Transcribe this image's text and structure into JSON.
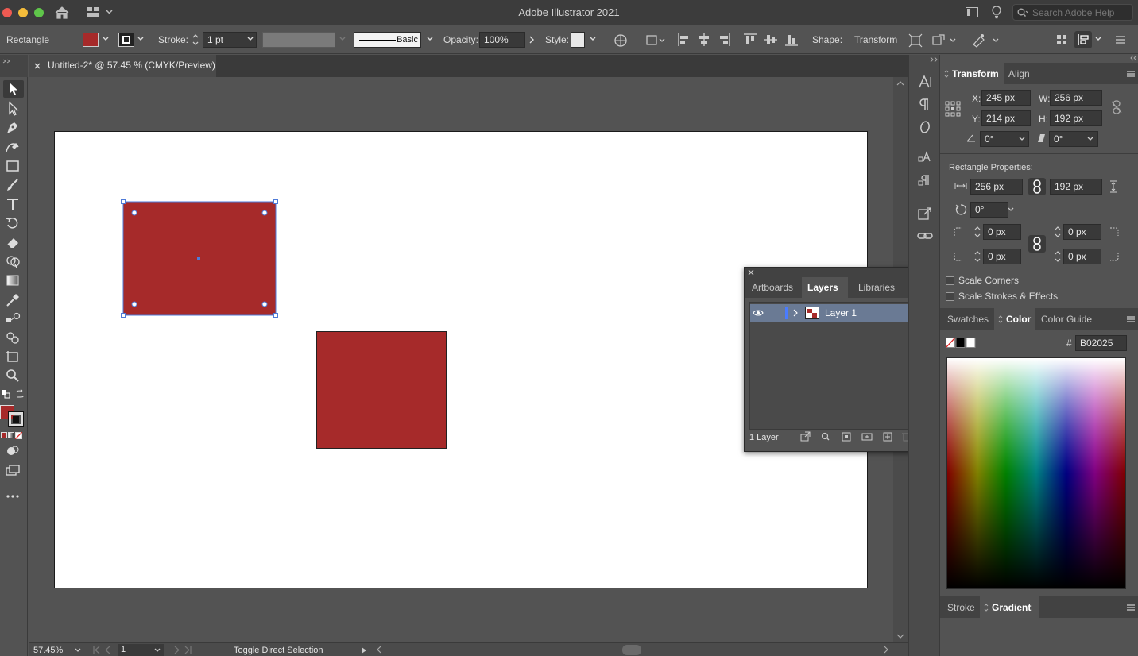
{
  "app": {
    "title": "Adobe Illustrator 2021"
  },
  "search": {
    "placeholder": "Search Adobe Help"
  },
  "control": {
    "object_type": "Rectangle",
    "stroke_label": "Stroke:",
    "stroke_weight": "1 pt",
    "brush_label": "Basic",
    "opacity_label": "Opacity:",
    "opacity_value": "100%",
    "style_label": "Style:",
    "shape_label": "Shape:",
    "transform_label": "Transform",
    "fill_color": "#a62a2a"
  },
  "document": {
    "tab_title": "Untitled-2* @ 57.45 % (CMYK/Preview)"
  },
  "status": {
    "zoom": "57.45%",
    "artboard_number": "1",
    "message": "Toggle Direct Selection"
  },
  "canvas": {
    "shapes": [
      {
        "name": "Rectangle",
        "selected": true,
        "fill": "#a62a2a"
      },
      {
        "name": "Rectangle",
        "selected": false,
        "fill": "#a62a2a"
      }
    ]
  },
  "layers_panel": {
    "tabs": [
      "Artboards",
      "Layers",
      "Libraries"
    ],
    "active_tab": "Layers",
    "layers": [
      {
        "name": "Layer 1",
        "visible": true
      }
    ],
    "footer_count": "1 Layer"
  },
  "transform_panel": {
    "tabs": [
      "Transform",
      "Align"
    ],
    "x": "245 px",
    "y": "214 px",
    "w": "256 px",
    "h": "192 px",
    "x_label": "X:",
    "y_label": "Y:",
    "w_label": "W:",
    "h_label": "H:",
    "angle": "0°",
    "shear": "0°",
    "rect_props_label": "Rectangle Properties:",
    "rect_width": "256 px",
    "rect_height": "192 px",
    "rect_angle": "0°",
    "corner_tl": "0 px",
    "corner_tr": "0 px",
    "corner_bl": "0 px",
    "corner_br": "0 px",
    "scale_corners": "Scale Corners",
    "scale_strokes": "Scale Strokes & Effects"
  },
  "color_panel": {
    "tabs": [
      "Swatches",
      "Color",
      "Color Guide"
    ],
    "active_tab": "Color",
    "hex_label": "#",
    "hex": "B02025"
  },
  "bottom_panel": {
    "tabs": [
      "Stroke",
      "Gradient"
    ],
    "active_tab": "Gradient"
  }
}
